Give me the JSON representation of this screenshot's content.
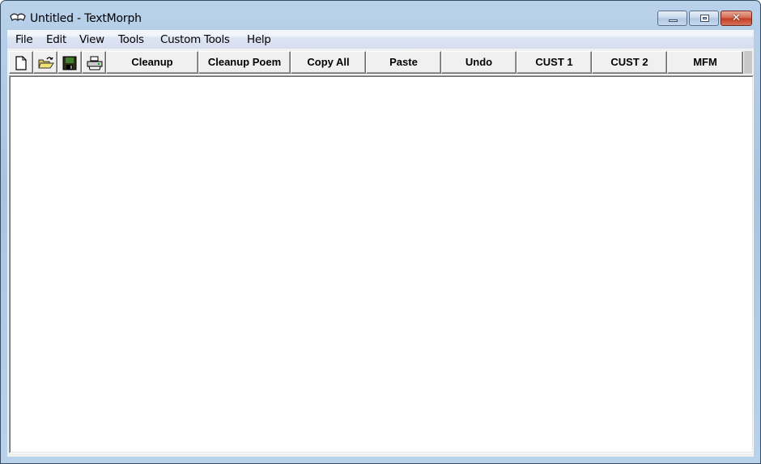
{
  "window": {
    "title": "Untitled - TextMorph",
    "app_icon": "open-book-icon",
    "controls": {
      "minimize_icon": "minimize-icon",
      "maximize_icon": "maximize-icon",
      "close_glyph": "✕"
    }
  },
  "menubar": {
    "items": [
      {
        "label": "File"
      },
      {
        "label": "Edit"
      },
      {
        "label": "View"
      },
      {
        "label": "Tools"
      },
      {
        "label": "Custom Tools"
      },
      {
        "label": "Help"
      }
    ]
  },
  "toolbar": {
    "icon_buttons": [
      {
        "icon": "new-document-icon"
      },
      {
        "icon": "open-folder-icon"
      },
      {
        "icon": "save-floppy-icon"
      },
      {
        "icon": "print-icon"
      }
    ],
    "buttons": [
      {
        "label": "Cleanup"
      },
      {
        "label": "Cleanup Poem"
      },
      {
        "label": "Copy All"
      },
      {
        "label": "Paste"
      },
      {
        "label": "Undo"
      },
      {
        "label": "CUST 1"
      },
      {
        "label": "CUST 2"
      },
      {
        "label": "MFM"
      }
    ]
  },
  "editor": {
    "value": ""
  }
}
